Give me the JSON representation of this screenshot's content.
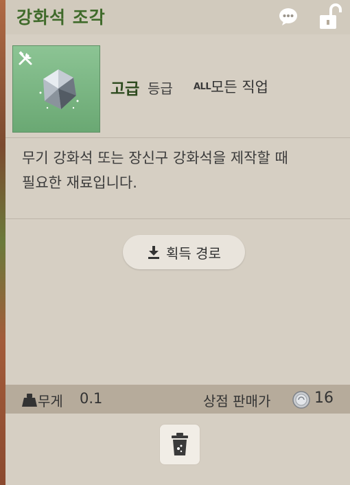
{
  "item": {
    "name": "강화석 조각",
    "grade": "고급",
    "grade_suffix": "등급",
    "class_badge": "ALL",
    "class_label": "모든 직업",
    "description": "무기 강화석 또는 장신구 강화석을 제작할 때\n필요한 재료입니다."
  },
  "actions": {
    "acquire_label": "획득 경로"
  },
  "footer": {
    "weight_label": "무게",
    "weight_value": "0.1",
    "price_label": "상점 판매가",
    "price_value": "16"
  },
  "colors": {
    "title": "#3f6a2a",
    "panel": "#d6cfc3",
    "icon_bg": "#7bb684",
    "footer": "#b6ab9b"
  },
  "icons": [
    "chat-icon",
    "lock-open-icon",
    "tool-icon",
    "gem-icon",
    "download-icon",
    "weight-icon",
    "coin-icon",
    "trash-icon"
  ]
}
